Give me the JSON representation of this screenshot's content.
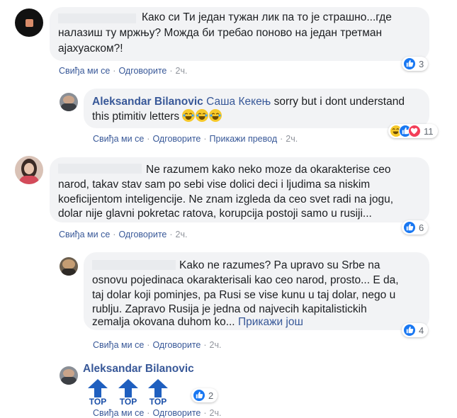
{
  "comments": [
    {
      "id": "c1",
      "text_l1": "Како си Ти један тужан лик па то је страшно...где",
      "text_l2": "налазиш ту мржњу? Можда би требао поново на један третман",
      "text_l3": "ајахуаском?!",
      "actions": {
        "like": "Свиђа ми се",
        "reply": "Одговорите",
        "time": "2ч."
      },
      "reactions": {
        "count": "3",
        "types": [
          "like"
        ]
      }
    },
    {
      "id": "r1",
      "author": "Aleksandar Bilanovic",
      "mention": "Саша Кекењ",
      "text_l1": " sorry but i dont understand",
      "text_l2": "this ptimitiv letters",
      "actions": {
        "like": "Свиђа ми се",
        "reply": "Одговорите",
        "translate": "Прикажи превод",
        "time": "2ч."
      },
      "reactions": {
        "count": "11",
        "types": [
          "haha",
          "like",
          "love"
        ]
      }
    },
    {
      "id": "c2",
      "text_l1": "Ne razumem kako neko moze da okarakterise ceo",
      "text_l2": "narod, takav stav sam po sebi vise dolici deci i ljudima sa niskim",
      "text_l3": "koeficijentom inteligencije. Ne znam izgleda da ceo svet radi na jogu,",
      "text_l4": "dolar nije glavni pokretac ratova, korupcija postoji samo u rusiji...",
      "actions": {
        "like": "Свиђа ми се",
        "reply": "Одговорите",
        "time": "2ч."
      },
      "reactions": {
        "count": "6",
        "types": [
          "like"
        ]
      }
    },
    {
      "id": "r2",
      "text_l1": "Kako ne razumes? Pa upravo su Srbe na",
      "text_l2": "osnovu pojedinaca okarakterisali kao ceo narod, prosto... E da,",
      "text_l3": "taj dolar koji pominjes, pa Rusi se vise kunu u taj dolar, nego u",
      "text_l4": "rublju. Zapravo Rusija je jedna od najvecih kapitalistickih",
      "text_l5": "zemalja okovana duhom ko...",
      "see_more": "Прикажи још",
      "actions": {
        "like": "Свиђа ми се",
        "reply": "Одговорите",
        "time": "2ч."
      },
      "reactions": {
        "count": "4",
        "types": [
          "like"
        ]
      }
    },
    {
      "id": "r3",
      "author": "Aleksandar Bilanovic",
      "sticker_label": "TOP",
      "actions": {
        "like": "Свиђа ми се",
        "reply": "Одговорите",
        "time": "2ч."
      },
      "reactions": {
        "count": "2",
        "types": [
          "like"
        ]
      }
    }
  ],
  "colors": {
    "link": "#385898",
    "bubble": "#f2f3f5",
    "like": "#1877f2",
    "meta": "#90949c"
  }
}
